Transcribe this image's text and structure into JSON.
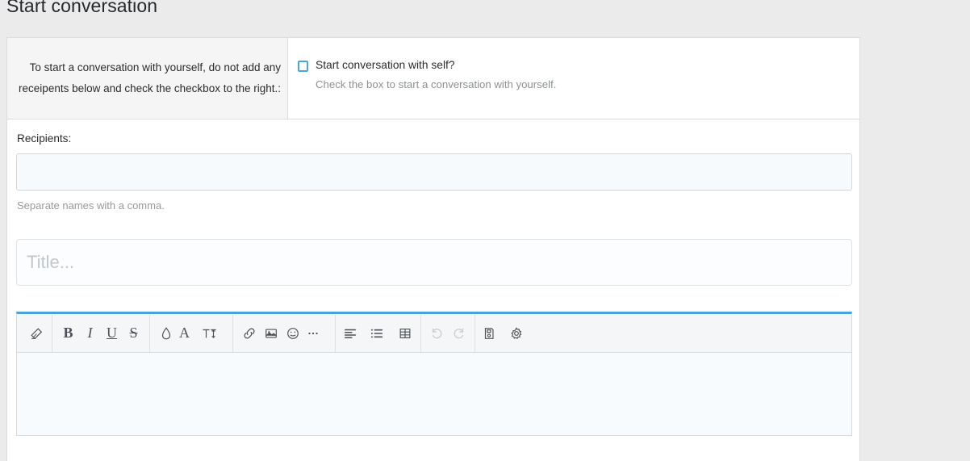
{
  "page": {
    "title": "Start conversation",
    "background_color": "#ebebeb",
    "panel_background": "#ffffff",
    "accent_color": "#4aa3d8",
    "checkbox_border_color": "#49a8e0"
  },
  "self_conversation": {
    "instruction": "To start a conversation with yourself, do not add any receipents below and check the checkbox to the right.:",
    "checkbox_label": "Start conversation with self?",
    "checkbox_checked": false,
    "checkbox_help": "Check the box to start a conversation with yourself."
  },
  "recipients": {
    "label": "Recipients:",
    "value": "",
    "placeholder": "",
    "help": "Separate names with a comma."
  },
  "title_field": {
    "value": "",
    "placeholder": "Title..."
  },
  "editor": {
    "body_value": "",
    "toolbar": [
      {
        "name": "remove-format-icon",
        "label": "",
        "icon": "eraser",
        "caret": false,
        "disabled": false
      },
      {
        "name": "bold-button",
        "label": "B",
        "icon": "text-bold",
        "caret": false,
        "disabled": false
      },
      {
        "name": "italic-button",
        "label": "I",
        "icon": "text-italic",
        "caret": false,
        "disabled": false
      },
      {
        "name": "underline-button",
        "label": "U",
        "icon": "text-underline",
        "caret": false,
        "disabled": false
      },
      {
        "name": "strikethrough-button",
        "label": "S",
        "icon": "text-strikethrough",
        "caret": false,
        "disabled": false
      },
      {
        "name": "highlight-color-button",
        "label": "",
        "icon": "droplet",
        "caret": false,
        "disabled": false
      },
      {
        "name": "font-color-button",
        "label": "A",
        "icon": "letter-a",
        "caret": true,
        "disabled": false
      },
      {
        "name": "font-size-button",
        "label": "",
        "icon": "font-size",
        "caret": true,
        "disabled": false
      },
      {
        "name": "link-button",
        "label": "",
        "icon": "link",
        "caret": false,
        "disabled": false
      },
      {
        "name": "image-button",
        "label": "",
        "icon": "image",
        "caret": false,
        "disabled": false
      },
      {
        "name": "emoji-button",
        "label": "",
        "icon": "smiley",
        "caret": false,
        "disabled": false
      },
      {
        "name": "more-options-button",
        "label": "",
        "icon": "ellipsis",
        "caret": true,
        "disabled": false
      },
      {
        "name": "align-button",
        "label": "",
        "icon": "align-left",
        "caret": true,
        "disabled": false
      },
      {
        "name": "list-button",
        "label": "",
        "icon": "unordered-list",
        "caret": true,
        "disabled": false
      },
      {
        "name": "table-button",
        "label": "",
        "icon": "table-grid",
        "caret": false,
        "disabled": false
      },
      {
        "name": "undo-button",
        "label": "",
        "icon": "undo-arrow",
        "caret": false,
        "disabled": true
      },
      {
        "name": "redo-button",
        "label": "",
        "icon": "redo-arrow",
        "caret": false,
        "disabled": true
      },
      {
        "name": "draft-button",
        "label": "",
        "icon": "draft-document",
        "caret": true,
        "disabled": false
      },
      {
        "name": "settings-button",
        "label": "",
        "icon": "gear",
        "caret": false,
        "disabled": false
      }
    ]
  }
}
